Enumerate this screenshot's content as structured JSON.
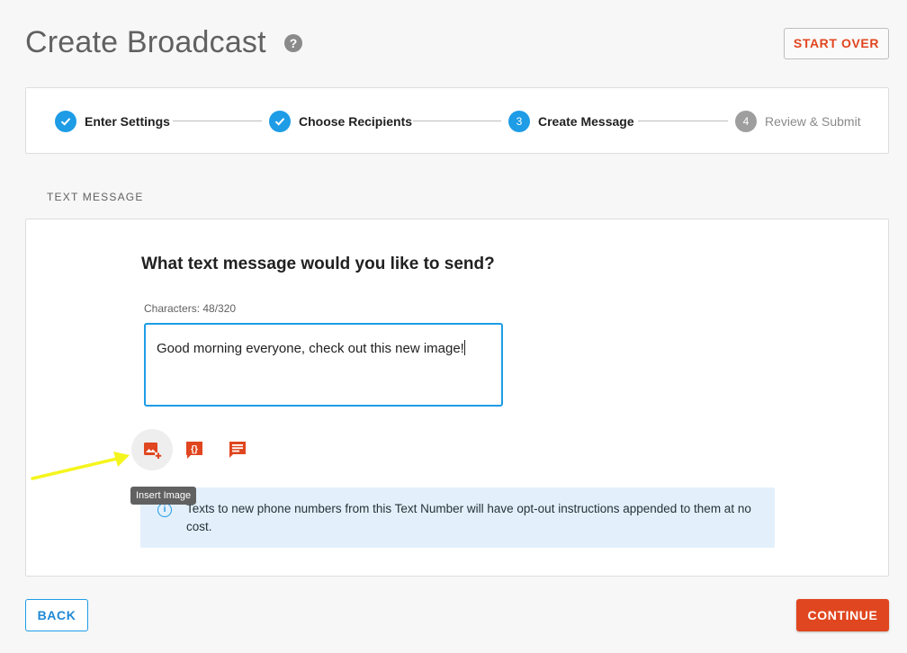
{
  "header": {
    "title": "Create Broadcast",
    "help_icon_glyph": "?",
    "start_over_label": "START OVER"
  },
  "stepper": {
    "steps": [
      {
        "number": "",
        "label": "Enter Settings",
        "state": "done"
      },
      {
        "number": "",
        "label": "Choose Recipients",
        "state": "done"
      },
      {
        "number": "3",
        "label": "Create Message",
        "state": "active"
      },
      {
        "number": "4",
        "label": "Review & Submit",
        "state": "todo"
      }
    ]
  },
  "section": {
    "label": "TEXT MESSAGE"
  },
  "composer": {
    "question": "What text message would you like to send?",
    "char_count": "Characters: 48/320",
    "message_value": "Good morning everyone, check out this new image!",
    "tools": [
      {
        "name": "insert-image-icon",
        "tooltip": "Insert Image"
      },
      {
        "name": "insert-variable-icon"
      },
      {
        "name": "saved-replies-icon"
      }
    ],
    "tooltip": "Insert Image"
  },
  "info": {
    "text": "Texts to new phone numbers from this Text Number will have opt-out instructions appended to them at no cost."
  },
  "footer": {
    "back_label": "BACK",
    "continue_label": "CONTINUE"
  },
  "colors": {
    "accent_blue": "#1e9ce6",
    "accent_orange": "#e0461f",
    "annotation_arrow": "#f5f51e"
  }
}
